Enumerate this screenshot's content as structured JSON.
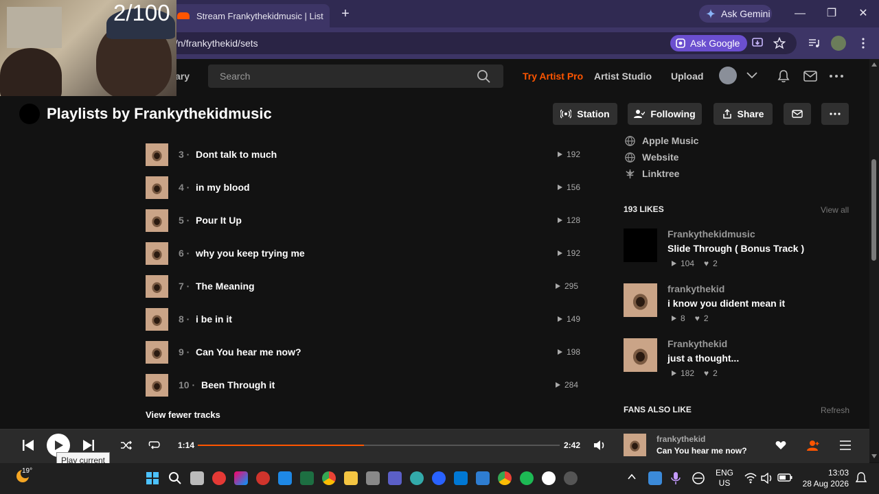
{
  "browser": {
    "tab_title": "Stream Frankythekidmusic | List",
    "new_tab": "+",
    "ask_gemini": "Ask Gemini",
    "url": "/n/frankythekid/sets",
    "ask_google": "Ask Google"
  },
  "webcam": {
    "counter": "2/100"
  },
  "header": {
    "library_label": "ary",
    "search_placeholder": "Search",
    "try_artist_pro": "Try Artist Pro",
    "artist_studio": "Artist Studio",
    "upload": "Upload"
  },
  "playlist": {
    "title": "Playlists by Frankythekidmusic",
    "actions": {
      "station": "Station",
      "following": "Following",
      "share": "Share"
    }
  },
  "tracks": [
    {
      "num": "3 ·",
      "name": "Dont talk to much",
      "plays": "192"
    },
    {
      "num": "4 ·",
      "name": "in my blood",
      "plays": "156"
    },
    {
      "num": "5 ·",
      "name": "Pour It Up",
      "plays": "128"
    },
    {
      "num": "6 ·",
      "name": "why you keep trying me",
      "plays": "192"
    },
    {
      "num": "7 ·",
      "name": "The Meaning",
      "plays": "295"
    },
    {
      "num": "8 ·",
      "name": "i be in it",
      "plays": "149"
    },
    {
      "num": "9 ·",
      "name": "Can You hear me now?",
      "plays": "198"
    },
    {
      "num": "10 ·",
      "name": "Been Through it",
      "plays": "284"
    }
  ],
  "view_fewer": "View fewer tracks",
  "links": [
    {
      "label": "Apple Music",
      "icon": "globe-icon"
    },
    {
      "label": "Website",
      "icon": "globe-icon"
    },
    {
      "label": "Linktree",
      "icon": "linktree-icon"
    }
  ],
  "likes": {
    "title": "193 LIKES",
    "view_all": "View all",
    "items": [
      {
        "user": "Frankythekidmusic",
        "song": "Slide Through ( Bonus Track )",
        "plays": "104",
        "likes": "2"
      },
      {
        "user": "frankythekid",
        "song": "i know you dident mean it",
        "plays": "8",
        "likes": "2"
      },
      {
        "user": "Frankythekid",
        "song": "just a thought...",
        "plays": "182",
        "likes": "2"
      }
    ]
  },
  "fans": {
    "title": "FANS ALSO LIKE",
    "refresh": "Refresh"
  },
  "player": {
    "current_time": "1:14",
    "duration": "2:42",
    "progress": 0.46,
    "now_user": "frankythekid",
    "now_song": "Can You hear me now?",
    "tooltip": "Play current"
  },
  "taskbar": {
    "temperature": "19°",
    "lang_line1": "ENG",
    "lang_line2": "US",
    "time": "13:03",
    "date": "28 Aug 2026"
  },
  "colors": {
    "accent": "#ff5500",
    "browser_frame": "#302a52"
  }
}
